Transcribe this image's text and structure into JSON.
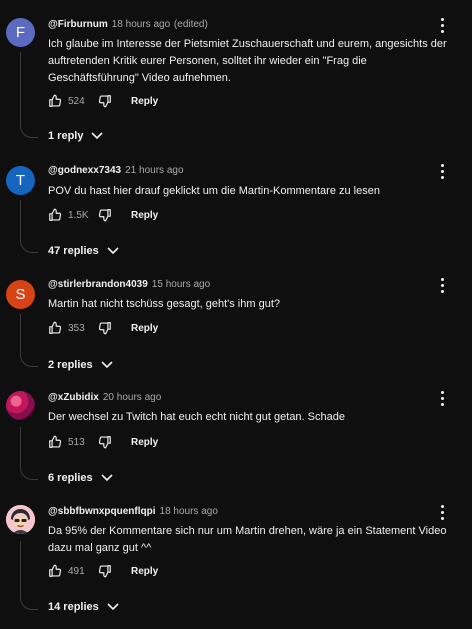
{
  "labels": {
    "reply": "Reply",
    "edited": "(edited)"
  },
  "comments": [
    {
      "author": "@Firburnum",
      "time": "18 hours ago",
      "edited": "(edited)",
      "avatar_letter": "F",
      "avatar_color": "#5c6bc0",
      "text": "Ich glaube im Interesse der Pietsmiet Zuschauerschaft und eurem, angesichts der auftretenden Kritik eurer Personen, solltet ihr wieder ein \"Frag die Geschäftsführung\" Video aufnehmen.",
      "likes": "524",
      "replies": "1 reply"
    },
    {
      "author": "@godnexx7343",
      "time": "21 hours ago",
      "avatar_letter": "T",
      "avatar_color": "#1565c0",
      "text": "POV du hast hier drauf geklickt um die Martin-Kommentare zu lesen",
      "likes": "1.5K",
      "replies": "47 replies"
    },
    {
      "author": "@stirlerbrandon4039",
      "time": "15 hours ago",
      "avatar_letter": "S",
      "avatar_color": "#d84315",
      "text": "Martin hat nicht tschüss gesagt, geht's ihm gut?",
      "likes": "353",
      "replies": "2 replies"
    },
    {
      "author": "@xZubidix",
      "time": "20 hours ago",
      "avatar_letter": "",
      "avatar_color": "#c2185b",
      "text": "Der wechsel zu Twitch hat euch echt nicht gut getan. Schade",
      "likes": "513",
      "replies": "6 replies"
    },
    {
      "author": "@sbbfbwnxpquenflqpi",
      "time": "18 hours ago",
      "avatar_letter": "",
      "avatar_color": "#f5c6cf",
      "text": "Da 95% der Kommentare sich nur um Martin drehen, wäre ja ein Statement Video dazu mal ganz gut ^^",
      "likes": "491",
      "replies": "14 replies"
    }
  ]
}
